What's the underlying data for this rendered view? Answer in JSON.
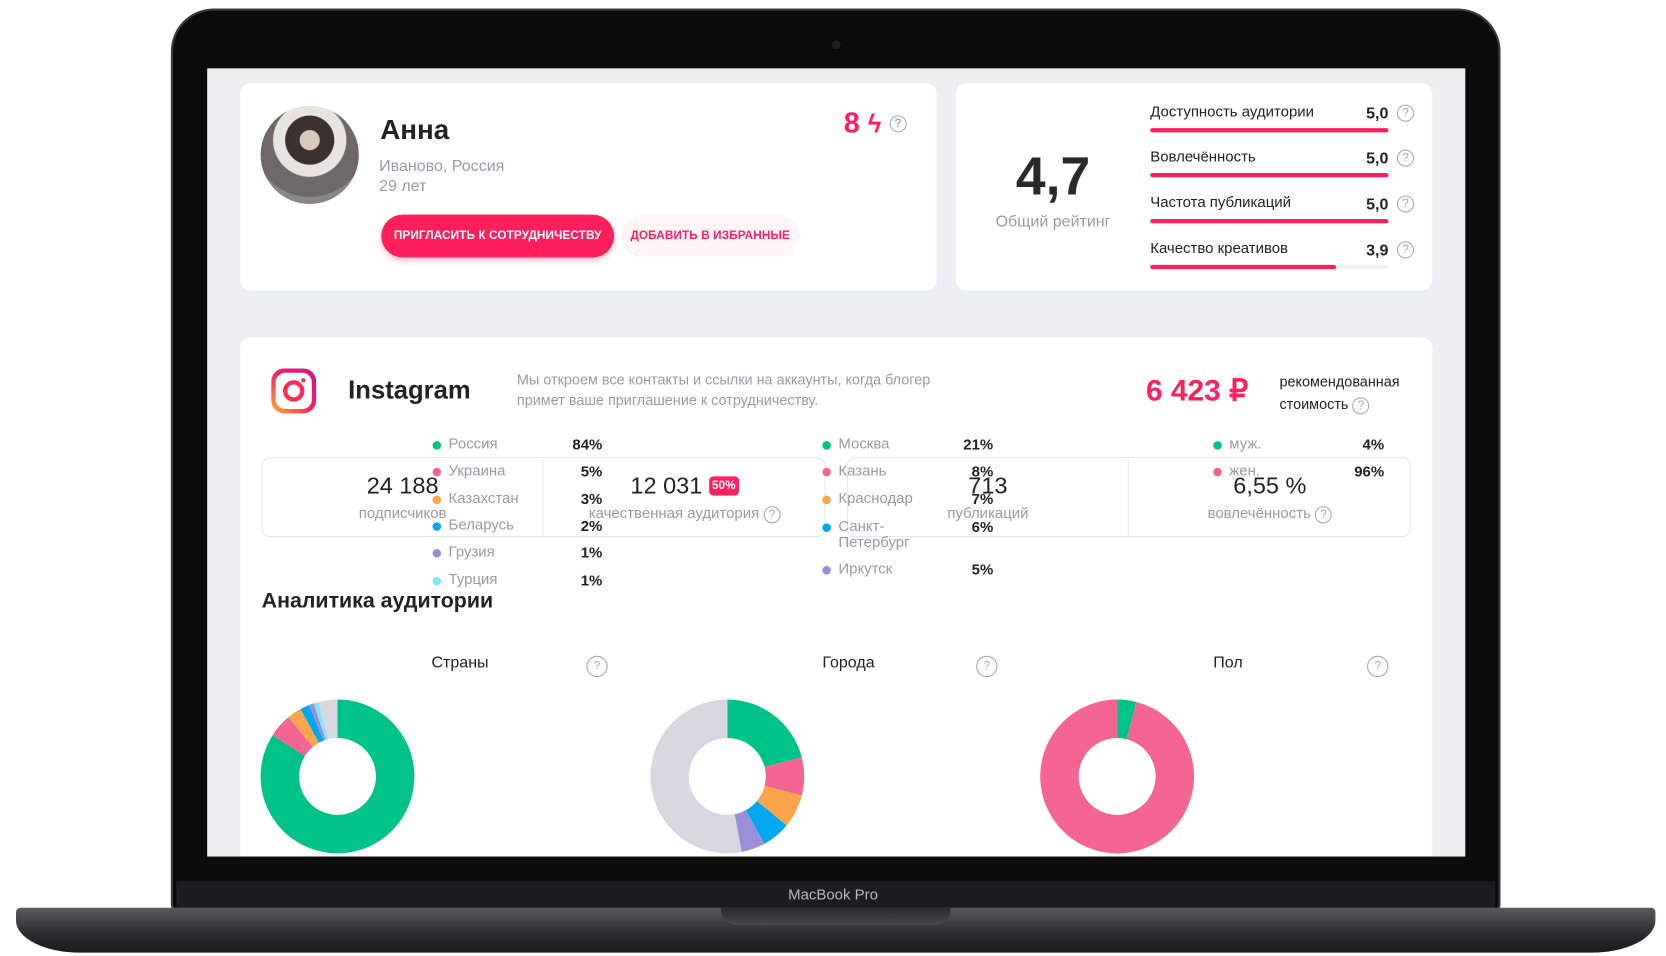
{
  "device": {
    "label": "MacBook Pro"
  },
  "profile": {
    "name": "Анна",
    "location": "Иваново, Россия",
    "age": "29 лет",
    "score": "8",
    "invite_label": "ПРИГЛАСИТЬ К СОТРУДНИЧЕСТВУ",
    "favorite_label": "ДОБАВИТЬ В ИЗБРАННЫЕ"
  },
  "rating": {
    "total": "4,7",
    "total_label": "Общий рейтинг",
    "max": 5,
    "items": [
      {
        "label": "Доступность аудитории",
        "value": "5,0",
        "score": 5.0
      },
      {
        "label": "Вовлечённость",
        "value": "5,0",
        "score": 5.0
      },
      {
        "label": "Частота публикаций",
        "value": "5,0",
        "score": 5.0
      },
      {
        "label": "Качество креативов",
        "value": "3,9",
        "score": 3.9
      }
    ]
  },
  "instagram": {
    "title": "Instagram",
    "note_line1": "Мы откроем все контакты и ссылки на аккаунты, когда блогер",
    "note_line2": "примет ваше приглашение к сотрудничеству.",
    "price": "6 423 ₽",
    "price_label1": "рекомендованная",
    "price_label2": "стоимость",
    "stats": [
      {
        "value": "24 188",
        "label": "подписчиков"
      },
      {
        "value": "12 031",
        "badge": "50%",
        "label": "качественная аудитория"
      },
      {
        "value": "713",
        "label": "публикаций"
      },
      {
        "value": "6,55 %",
        "label": "вовлечённость"
      }
    ]
  },
  "analytics": {
    "title": "Аналитика аудитории"
  },
  "colors": {
    "accent": "#ff1e5e",
    "green": "#00c389",
    "pink": "#f56593",
    "orange": "#fca44a",
    "blue": "#00a8ef",
    "purple": "#9b8fd9",
    "cyan": "#7ee8f8",
    "other": "#d9d8e0"
  },
  "chart_data": [
    {
      "type": "pie",
      "title": "Страны",
      "categories": [
        "Россия",
        "Украина",
        "Казахстан",
        "Беларусь",
        "Грузия",
        "Турция"
      ],
      "values": [
        84,
        5,
        3,
        2,
        1,
        1
      ],
      "labels": [
        "84%",
        "5%",
        "3%",
        "2%",
        "1%",
        "1%"
      ],
      "colors": [
        "#00c389",
        "#f56593",
        "#fca44a",
        "#00a8ef",
        "#9b8fd9",
        "#7ee8f8"
      ]
    },
    {
      "type": "pie",
      "title": "Города",
      "categories": [
        "Москва",
        "Казань",
        "Краснодар",
        "Санкт-Петербург",
        "Иркутск"
      ],
      "values": [
        21,
        8,
        7,
        6,
        5
      ],
      "labels": [
        "21%",
        "8%",
        "7%",
        "6%",
        "5%"
      ],
      "colors": [
        "#00c389",
        "#f56593",
        "#fca44a",
        "#00a8ef",
        "#9b8fd9"
      ]
    },
    {
      "type": "pie",
      "title": "Пол",
      "categories": [
        "муж.",
        "жен."
      ],
      "values": [
        4,
        96
      ],
      "labels": [
        "4%",
        "96%"
      ],
      "colors": [
        "#00c389",
        "#f56593"
      ]
    }
  ]
}
